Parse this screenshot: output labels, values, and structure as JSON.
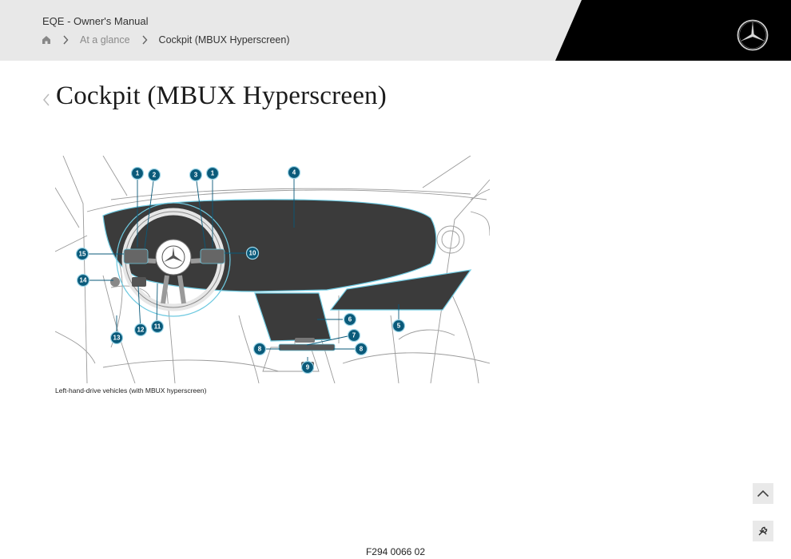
{
  "header": {
    "manual_title": "EQE - Owner's Manual",
    "breadcrumb": {
      "home_icon": "home-icon",
      "items": [
        {
          "label": "At a glance"
        },
        {
          "label": "Cockpit (MBUX Hyperscreen)"
        }
      ]
    },
    "logo_icon": "mercedes-star-icon"
  },
  "page": {
    "title": "Cockpit (MBUX Hyperscreen)",
    "figure": {
      "caption": "Left-hand-drive vehicles (with MBUX hyperscreen)",
      "image_code": "F294 0066 02",
      "callouts": [
        "1",
        "2",
        "3",
        "1",
        "4",
        "15",
        "10",
        "14",
        "5",
        "6",
        "7",
        "8",
        "8",
        "12",
        "11",
        "13",
        "9"
      ]
    }
  },
  "controls": {
    "scroll_top_icon": "chevron-up-icon",
    "tool_icon": "wrench-icon"
  },
  "colors": {
    "header_bg": "#e8e8e8",
    "header_black": "#000000",
    "callout_fill": "#0a5a7a",
    "screen_fill": "#3a3a3a",
    "highlight": "#6ec9e0"
  }
}
